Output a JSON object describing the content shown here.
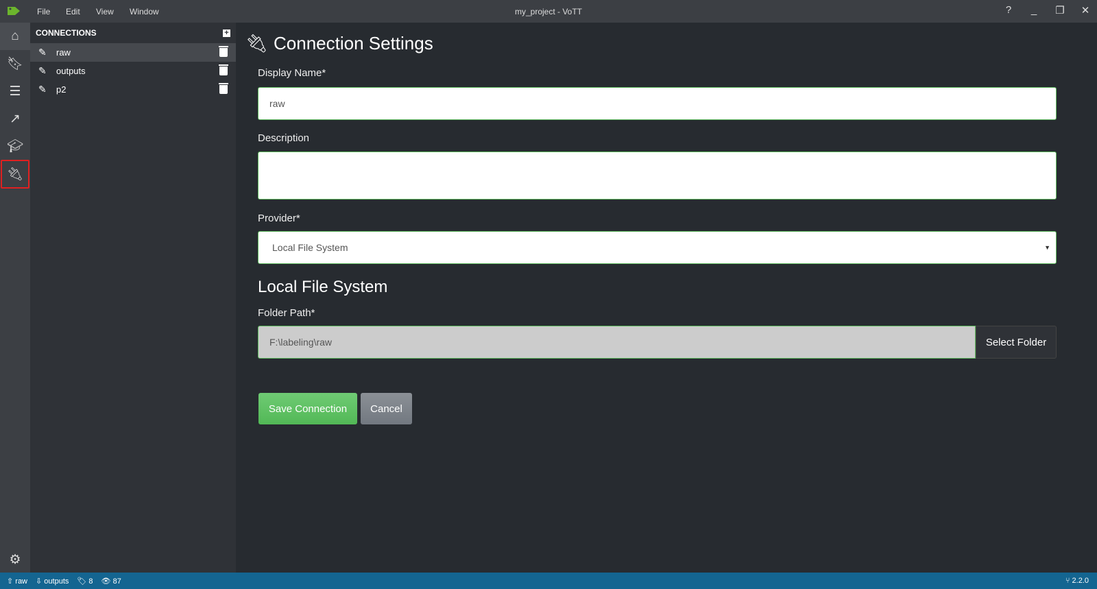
{
  "titlebar": {
    "title": "my_project - VoTT",
    "menu": [
      "File",
      "Edit",
      "View",
      "Window"
    ],
    "logo_color": "#6cb52d"
  },
  "rail": {
    "items": [
      "home-icon",
      "bookmark-icon",
      "sliders-icon",
      "export-icon",
      "graduation-cap-icon",
      "plug-icon"
    ],
    "active": "plug-icon",
    "settings": "gear-icon"
  },
  "connections": {
    "header": "CONNECTIONS",
    "items": [
      {
        "label": "raw",
        "selected": true
      },
      {
        "label": "outputs"
      },
      {
        "label": "p2"
      }
    ]
  },
  "form": {
    "title": "Connection Settings",
    "display_name_label": "Display Name*",
    "display_name_value": "raw",
    "description_label": "Description",
    "description_value": "",
    "provider_label": "Provider*",
    "provider_value": "Local File System",
    "section_title": "Local File System",
    "folder_label": "Folder Path*",
    "folder_value": "F:\\labeling\\raw",
    "select_folder": "Select Folder",
    "save": "Save Connection",
    "cancel": "Cancel"
  },
  "status": {
    "source": "raw",
    "target": "outputs",
    "tags": "8",
    "visited": "87",
    "version": "2.2.0"
  },
  "colors": {
    "accent_green": "#5cb85c",
    "status_bar": "#146591"
  }
}
